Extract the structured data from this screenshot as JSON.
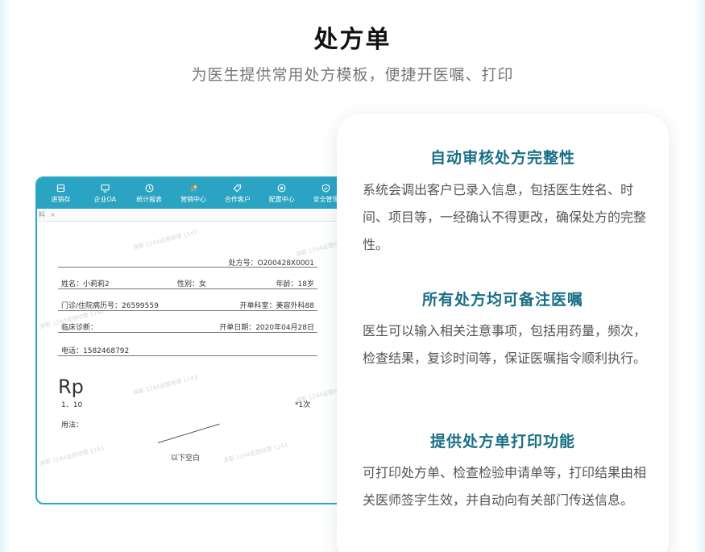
{
  "header": {
    "title": "处方单",
    "subtitle": "为医生提供常用处方模板，便捷开医嘱、打印"
  },
  "mockup": {
    "nav": [
      {
        "label": "进销存",
        "icon": "archive-icon"
      },
      {
        "label": "企业OA",
        "icon": "monitor-icon"
      },
      {
        "label": "统计报表",
        "icon": "clock-icon"
      },
      {
        "label": "营销中心",
        "icon": "sparkle-icon"
      },
      {
        "label": "合作客户",
        "icon": "tag-icon"
      },
      {
        "label": "配置中心",
        "icon": "settings-icon"
      },
      {
        "label": "安全管理",
        "icon": "shield-icon"
      }
    ],
    "tab": {
      "label": "料",
      "close": "×"
    },
    "watermark": "演都 1244运营经理 1143",
    "form": {
      "rx_no": "处方号：O200428X0001",
      "name": "姓名：小莉莉2",
      "gender": "性别：女",
      "age": "年龄：18岁",
      "record_no": "门诊/住院病历号：26599559",
      "dept": "开单科室：美容外科88",
      "diagnosis": "临床诊断：",
      "date": "开单日期：2020年04月28日",
      "phone": "电话：1582468792"
    },
    "rp": "Rp",
    "item_left": "1、10",
    "item_right": "*1次",
    "usage": "用法：",
    "blank": "以下空白"
  },
  "features": [
    {
      "title": "自动审核处方完整性",
      "desc": "系统会调出客户已录入信息，包括医生姓名、时间、项目等，一经确认不得更改，确保处方的完整性。"
    },
    {
      "title": "所有处方均可备注医嘱",
      "desc": "医生可以输入相关注意事项，包括用药量，频次，检查结果，复诊时间等，保证医嘱指令顺利执行。"
    },
    {
      "title": "提供处方单打印功能",
      "desc": "可打印处方单、检查检验申请单等，打印结果由相关医师签字生效，并自动向有关部门传送信息。"
    }
  ]
}
